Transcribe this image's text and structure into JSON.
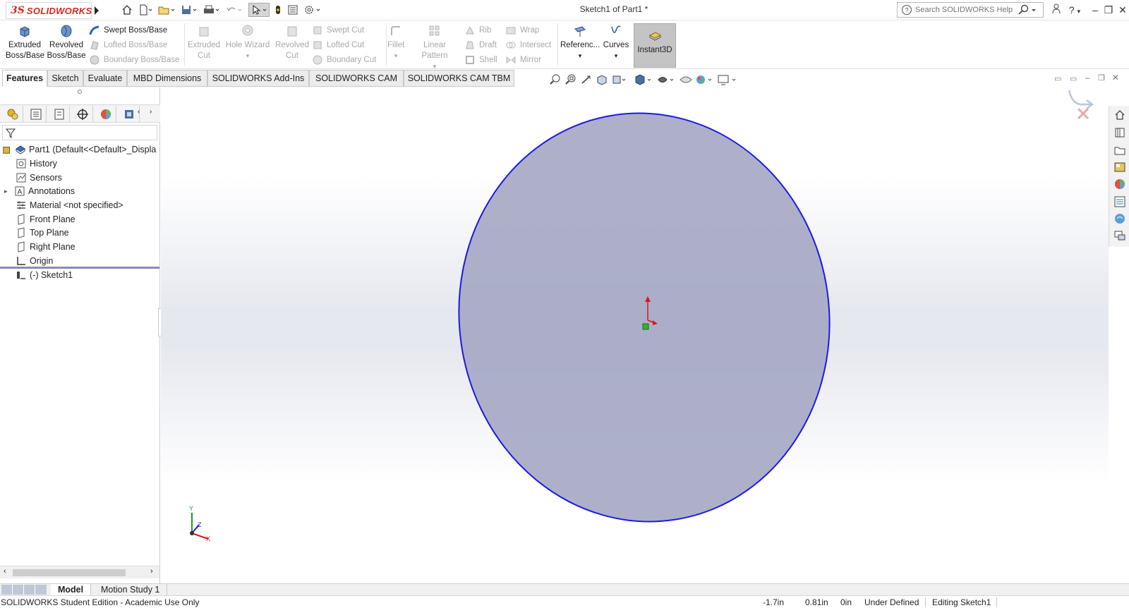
{
  "app": {
    "logo_text": "SOLIDWORKS",
    "window_title": "Sketch1 of Part1 *",
    "search_placeholder": "Search SOLIDWORKS Help"
  },
  "command_manager": {
    "extruded_boss": [
      "Extruded",
      "Boss/Base"
    ],
    "revolved_boss": [
      "Revolved",
      "Boss/Base"
    ],
    "swept_boss": "Swept Boss/Base",
    "lofted_boss": "Lofted Boss/Base",
    "boundary_boss": "Boundary Boss/Base",
    "extruded_cut": [
      "Extruded",
      "Cut"
    ],
    "hole_wizard": "Hole Wizard",
    "revolved_cut": [
      "Revolved",
      "Cut"
    ],
    "swept_cut": "Swept Cut",
    "lofted_cut": "Lofted Cut",
    "boundary_cut": "Boundary Cut",
    "fillet": "Fillet",
    "linear_pattern": "Linear Pattern",
    "rib": "Rib",
    "draft": "Draft",
    "shell": "Shell",
    "wrap": "Wrap",
    "intersect": "Intersect",
    "mirror": "Mirror",
    "reference": "Referenc...",
    "curves": "Curves",
    "instant3d": "Instant3D"
  },
  "tabs": [
    "Features",
    "Sketch",
    "Evaluate",
    "MBD Dimensions",
    "SOLIDWORKS Add-Ins",
    "SOLIDWORKS CAM",
    "SOLIDWORKS CAM TBM"
  ],
  "feature_tree": {
    "part": "Part1  (Default<<Default>_Displa",
    "items": [
      "History",
      "Sensors",
      "Annotations",
      "Material <not specified>",
      "Front Plane",
      "Top Plane",
      "Right Plane",
      "Origin",
      "(-) Sketch1"
    ]
  },
  "triad": {
    "x": "X",
    "y": "Y",
    "z": "Z"
  },
  "bottom_tabs": [
    "Model",
    "Motion Study 1"
  ],
  "status": {
    "edition": "SOLIDWORKS Student Edition - Academic Use Only",
    "x_coord": "-1.7in",
    "y_coord": "0.81in",
    "z_coord": "0in",
    "definition": "Under Defined",
    "mode": "Editing Sketch1"
  },
  "colors": {
    "sketch_outline": "#1a1ae6",
    "sketch_fill": "#a4a6c4",
    "brand_red": "#d52b1e",
    "instant3d_active": "#c4c4c4"
  }
}
